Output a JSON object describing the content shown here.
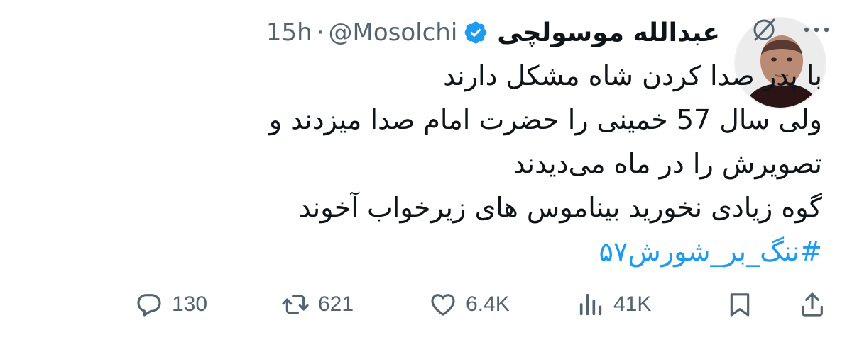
{
  "author": {
    "display_name": "عبدالله موسولچی",
    "handle": "@Mosolchi",
    "separator": "·",
    "time": "15h",
    "verified": true
  },
  "tweet": {
    "lines": [
      "با پدر صدا کردن شاه مشکل دارند",
      "ولی سال 57 خمینی را حضرت امام صدا میزدند و",
      "تصویرش را در ماه می‌دیدند",
      "گوه زیادی نخورید بیناموس های زیرخواب آخوند"
    ],
    "hashtag": "#ننگ_بر_شورش۵۷"
  },
  "actions": {
    "replies": "130",
    "retweets": "621",
    "likes": "6.4K",
    "views": "41K"
  },
  "icons": {
    "reply": "reply-icon",
    "retweet": "retweet-icon",
    "like": "heart-icon",
    "views": "views-icon",
    "bookmark": "bookmark-icon",
    "share": "share-icon",
    "grok": "grok-icon",
    "more": "more-icon"
  },
  "colors": {
    "text": "#0f1419",
    "secondary": "#536471",
    "accent": "#1d9bf0"
  }
}
